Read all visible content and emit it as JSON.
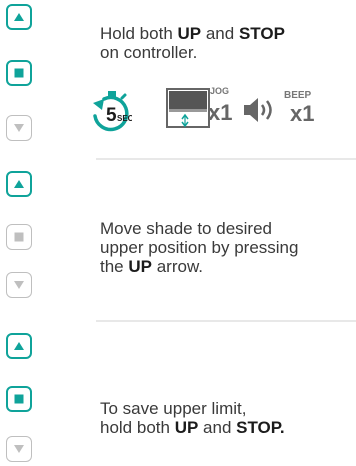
{
  "steps": [
    {
      "lines": [
        {
          "parts": [
            {
              "t": "Hold both ",
              "b": false
            },
            {
              "t": "UP",
              "b": true
            },
            {
              "t": " and ",
              "b": false
            },
            {
              "t": "STOP",
              "b": true
            }
          ]
        },
        {
          "parts": [
            {
              "t": "on controller.",
              "b": false
            }
          ]
        }
      ],
      "buttons": {
        "up": "active",
        "stop": "active",
        "down": "inactive"
      }
    },
    {
      "lines": [
        {
          "parts": [
            {
              "t": "Move shade to desired",
              "b": false
            }
          ]
        },
        {
          "parts": [
            {
              "t": "upper position by pressing",
              "b": false
            }
          ]
        },
        {
          "parts": [
            {
              "t": "the ",
              "b": false
            },
            {
              "t": "UP",
              "b": true
            },
            {
              "t": " arrow.",
              "b": false
            }
          ]
        }
      ],
      "buttons": {
        "up": "active",
        "stop": "inactive",
        "down": "inactive"
      }
    },
    {
      "lines": [
        {
          "parts": [
            {
              "t": "To save upper limit,",
              "b": false
            }
          ]
        },
        {
          "parts": [
            {
              "t": "hold both ",
              "b": false
            },
            {
              "t": "UP",
              "b": true
            },
            {
              "t": " and ",
              "b": false
            },
            {
              "t": "STOP.",
              "b": true
            }
          ]
        }
      ],
      "buttons": {
        "up": "active",
        "stop": "active",
        "down": "inactive"
      }
    }
  ],
  "indicators": {
    "timer_number": "5",
    "timer_unit": "SECS",
    "jog_label": "JOG",
    "jog_count": "x1",
    "beep_label": "BEEP",
    "beep_count": "x1"
  },
  "icons": [
    "up-arrow-icon",
    "stop-square-icon",
    "down-arrow-icon",
    "stopwatch-icon",
    "shade-jog-icon",
    "speaker-icon"
  ],
  "colors": {
    "accent": "#0fa39a",
    "inactive": "#bfbfbf",
    "text": "#3a3a3a",
    "bold_text": "#1c1c1c",
    "divider": "#e8e8e8"
  }
}
